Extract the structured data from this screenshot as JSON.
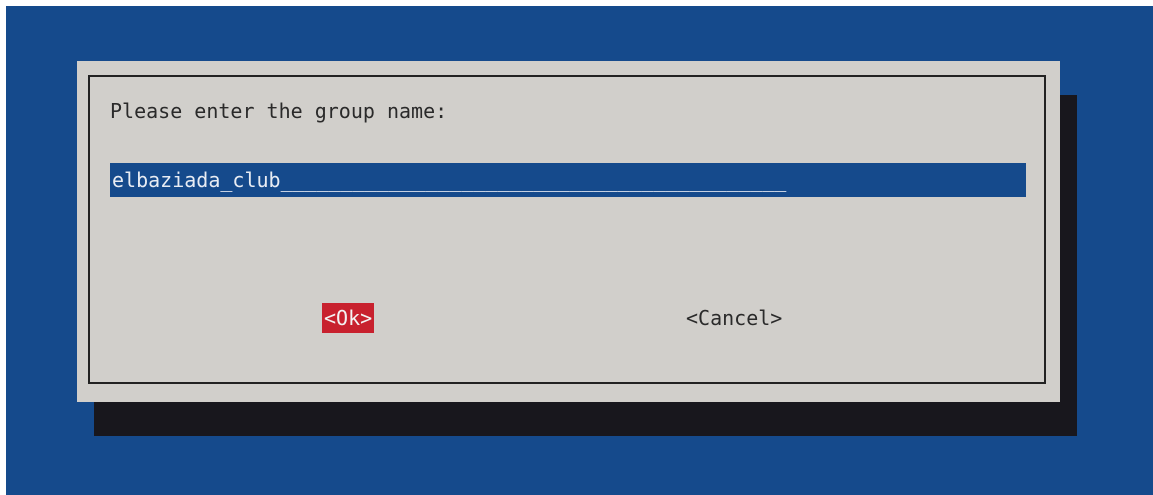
{
  "dialog": {
    "prompt": "Please enter the group name:",
    "input": {
      "value": "elbaziada_club",
      "fill": "__________________________________________"
    },
    "buttons": {
      "ok": "<Ok>",
      "cancel": "<Cancel>"
    }
  },
  "colors": {
    "background": "#154a8c",
    "dialog": "#d1cfcb",
    "shadow": "#18171d",
    "selected_button": "#c8212e",
    "input_field": "#154a8c"
  }
}
